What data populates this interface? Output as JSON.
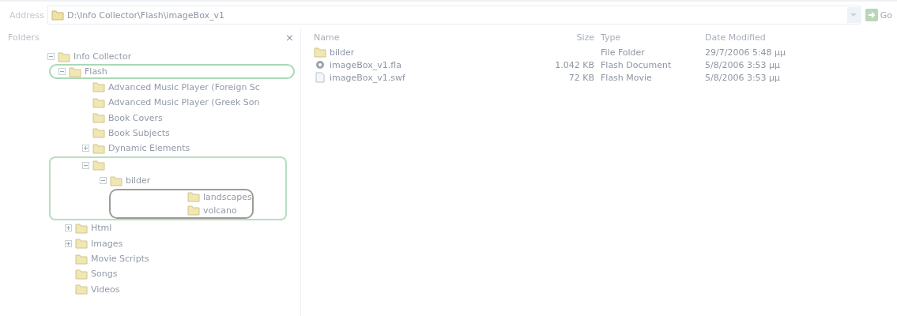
{
  "address_bar": {
    "label": "Address",
    "path": "D:\\Info Collector\\Flash\\imageBox_v1",
    "go": "Go"
  },
  "folders_pane": {
    "title": "Folders",
    "close": "×",
    "tree": [
      {
        "name": "Info Collector",
        "expanded": true,
        "children": [
          {
            "name": "Flash",
            "expanded": true,
            "circled": true,
            "children": [
              {
                "name": "Advanced Music Player (Foreign Sc"
              },
              {
                "name": "Advanced Music Player (Greek Son"
              },
              {
                "name": "Book Covers"
              },
              {
                "name": "Book Subjects"
              },
              {
                "name": "Dynamic Elements",
                "expanded": false
              },
              {
                "expanded": true,
                "boxed": true,
                "children": [
                  {
                    "name": "bilder",
                    "expanded": true,
                    "circled_children": true,
                    "children": [
                      {
                        "name": "landscapes"
                      },
                      {
                        "name": "volcano"
                      }
                    ]
                  }
                ]
              }
            ]
          },
          {
            "name": "Html",
            "expanded": false
          },
          {
            "name": "Images",
            "expanded": false
          },
          {
            "name": "Movie Scripts"
          },
          {
            "name": "Songs"
          },
          {
            "name": "Videos"
          }
        ]
      }
    ]
  },
  "file_list": {
    "columns": [
      "Name",
      "Size",
      "Type",
      "Date Modified"
    ],
    "rows": [
      {
        "kind": "folder",
        "name": "bilder",
        "size": "",
        "type": "File Folder",
        "modified": "29/7/2006 5:48 μμ"
      },
      {
        "kind": "document",
        "name": "imageBox_v1.fla",
        "size": "1.042 KB",
        "type": "Flash Document",
        "modified": "5/8/2006 3:53 μμ"
      },
      {
        "kind": "movie",
        "name": "imageBox_v1.swf",
        "size": "72 KB",
        "type": "Flash Movie",
        "modified": "5/8/2006 3:53 μμ"
      }
    ]
  }
}
